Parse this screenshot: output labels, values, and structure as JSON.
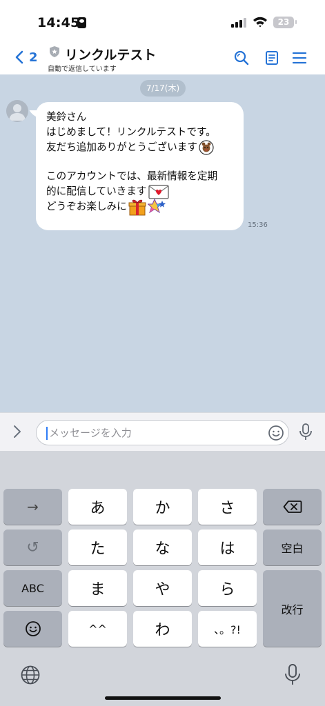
{
  "status_bar": {
    "time": "14:45",
    "battery": "23"
  },
  "header": {
    "back_count": "2",
    "title": "リンクルテスト",
    "subtitle": "自動で返信しています"
  },
  "chat": {
    "date": "7/17(木)",
    "message": {
      "lines": [
        "美鈴さん",
        "はじめまして！リンクルテストです。",
        "友だち追加ありがとうございます",
        "このアカウントでは、最新情報を定期",
        "的に配信していきます",
        "どうぞお楽しみに"
      ],
      "emojis": [
        "smiling-brown-bear-emoji",
        "love-letter-emoji",
        "gift-emoji",
        "shooting-star-emoji"
      ],
      "time": "15:36"
    }
  },
  "input": {
    "placeholder": "メッセージを入力",
    "value": ""
  },
  "keyboard": {
    "rows": [
      [
        "→",
        "あ",
        "か",
        "さ",
        "⌫"
      ],
      [
        "↺",
        "た",
        "な",
        "は",
        "空白"
      ],
      [
        "ABC",
        "ま",
        "や",
        "ら",
        "改行"
      ],
      [
        "☺",
        "^^",
        "わ",
        "、。?!"
      ]
    ],
    "arrow_key": "→",
    "undo_key": "↺",
    "row1": [
      "あ",
      "か",
      "さ"
    ],
    "row2": [
      "た",
      "な",
      "は"
    ],
    "row3": [
      "ま",
      "や",
      "ら"
    ],
    "row4": [
      "^^",
      "わ",
      "、。?!"
    ],
    "abc_key": "ABC",
    "space_key": "空白",
    "return_key": "改行"
  },
  "colors": {
    "accent": "#2573d6",
    "chat_background": "#c8d5e3",
    "keyboard_background": "#d2d5db",
    "dark_key": "#abb0ba"
  }
}
